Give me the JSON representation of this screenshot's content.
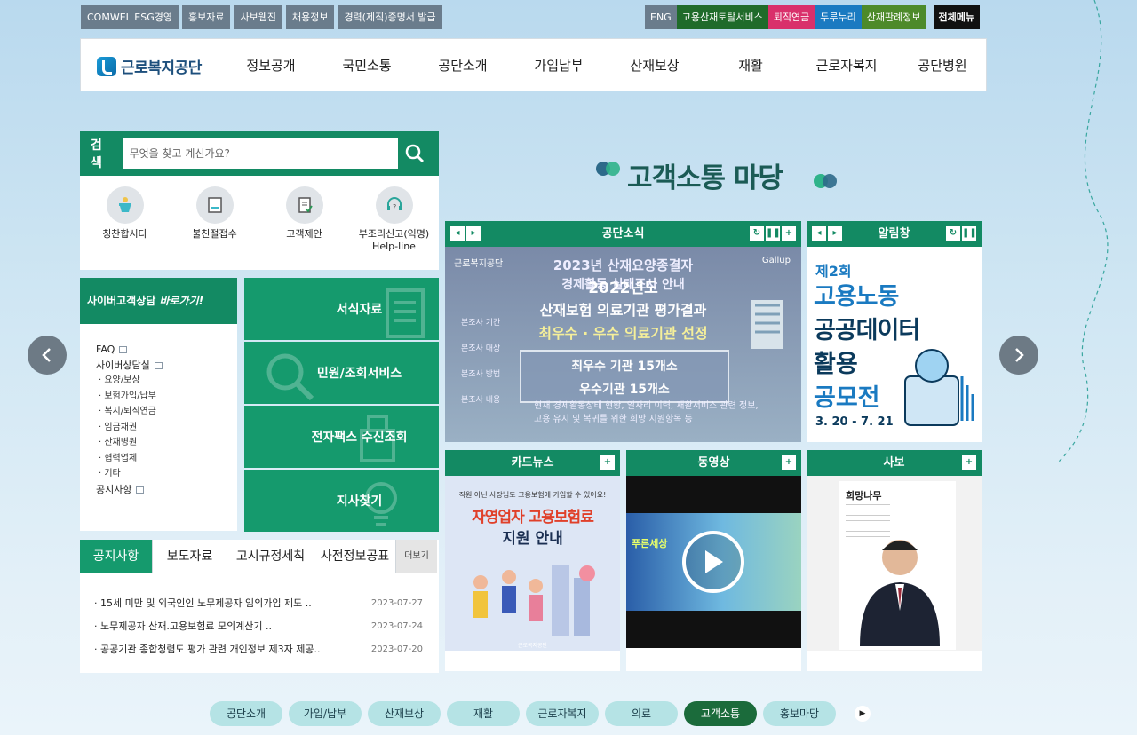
{
  "util_left": [
    "COMWEL ESG경영",
    "홍보자료",
    "사보웹진",
    "채용정보",
    "경력(제직)증명서 발급"
  ],
  "util_right": [
    {
      "label": "ENG",
      "color": "#6a7c8c"
    },
    {
      "label": "고용산재토탈서비스",
      "color": "#1f6b2a"
    },
    {
      "label": "퇴직연금",
      "color": "#d9306b"
    },
    {
      "label": "두루누리",
      "color": "#1a7ac1"
    },
    {
      "label": "산재판례정보",
      "color": "#4d8a2a"
    }
  ],
  "all_menu": "전체메뉴",
  "logo_text": "근로복지공단",
  "gnb": [
    "정보공개",
    "국민소통",
    "공단소개",
    "가입납부",
    "산재보상",
    "재활",
    "근로자복지",
    "공단병원"
  ],
  "search": {
    "label": "검색",
    "placeholder": "무엇을 찾고 계신가요?"
  },
  "quick_links": [
    "칭찬합시다",
    "불친절접수",
    "고객제안",
    "부조리신고(익명)",
    "Help-line"
  ],
  "cyber": {
    "title_a": "사이버고객상담",
    "title_b": "바로가기!",
    "items": [
      "FAQ",
      "사이버상담실",
      "· 요양/보상",
      "· 보험가입/납부",
      "· 복지/퇴직연금",
      "· 임금채권",
      "· 산재병원",
      "· 협력업체",
      "· 기타",
      "공지사항"
    ]
  },
  "tiles": [
    "서식자료",
    "민원/조회서비스",
    "전자팩스 수신조회",
    "지사찾기"
  ],
  "notice": {
    "tabs": [
      "공지사항",
      "보도자료",
      "고시규정세칙",
      "사전정보공표"
    ],
    "more": "더보기",
    "rows": [
      {
        "title": "15세 미만 및 외국인인 노무제공자 임의가입 제도 ..",
        "date": "2023-07-27"
      },
      {
        "title": "노무제공자 산재.고용보험료 모의계산기 ..",
        "date": "2023-07-24"
      },
      {
        "title": "공공기관 종합청렴도 평가 관련 개인정보 제3자 제공..",
        "date": "2023-07-20"
      }
    ]
  },
  "main_title": "고객소통 마당",
  "cards": {
    "news": {
      "title": "공단소식",
      "brand": "근로복지공단",
      "gallup": "Gallup",
      "line1": "2023년 산재요양종결자",
      "line2": "경제활동 실태조사 안내",
      "overlay1": "2022년도",
      "overlay2": "산재보험 의료기관 평가결과",
      "overlay3": "최우수 · 우수 의료기관 선정",
      "box1": "최우수 기관 15개소",
      "box2": "우수기관 15개소",
      "labels": [
        "본조사 기간",
        "본조사 대상",
        "본조사 방법",
        "본조사 내용"
      ],
      "content_a": "현재 경제활동상태 현황, 일자리 이력, 재활서비스 관련 정보,",
      "content_b": "고용 유지 및 복귀를 위한 희망 지원항목 등"
    },
    "alarm": {
      "title": "알림창",
      "l1": "제2회",
      "l2": "고용노동",
      "l3": "공공데이터",
      "l4": "활용",
      "l5": "공모전",
      "date": "3. 20 - 7. 21"
    },
    "cardnews": {
      "title": "카드뉴스",
      "top": "직원 아닌 사장님도 고용보험에 가입할 수 있어요!",
      "h1": "자영업자 고용보험료",
      "h2": "지원 안내",
      "foot": "근로복지공단"
    },
    "video": {
      "title": "동영상",
      "caption": "푸른세상"
    },
    "sabo": {
      "title": "사보",
      "brand": "희망나무"
    }
  },
  "bottom_tabs": [
    "공단소개",
    "가입/납부",
    "산재보상",
    "재활",
    "근로자복지",
    "의료",
    "고객소통",
    "홍보마당"
  ],
  "bottom_active": 6
}
